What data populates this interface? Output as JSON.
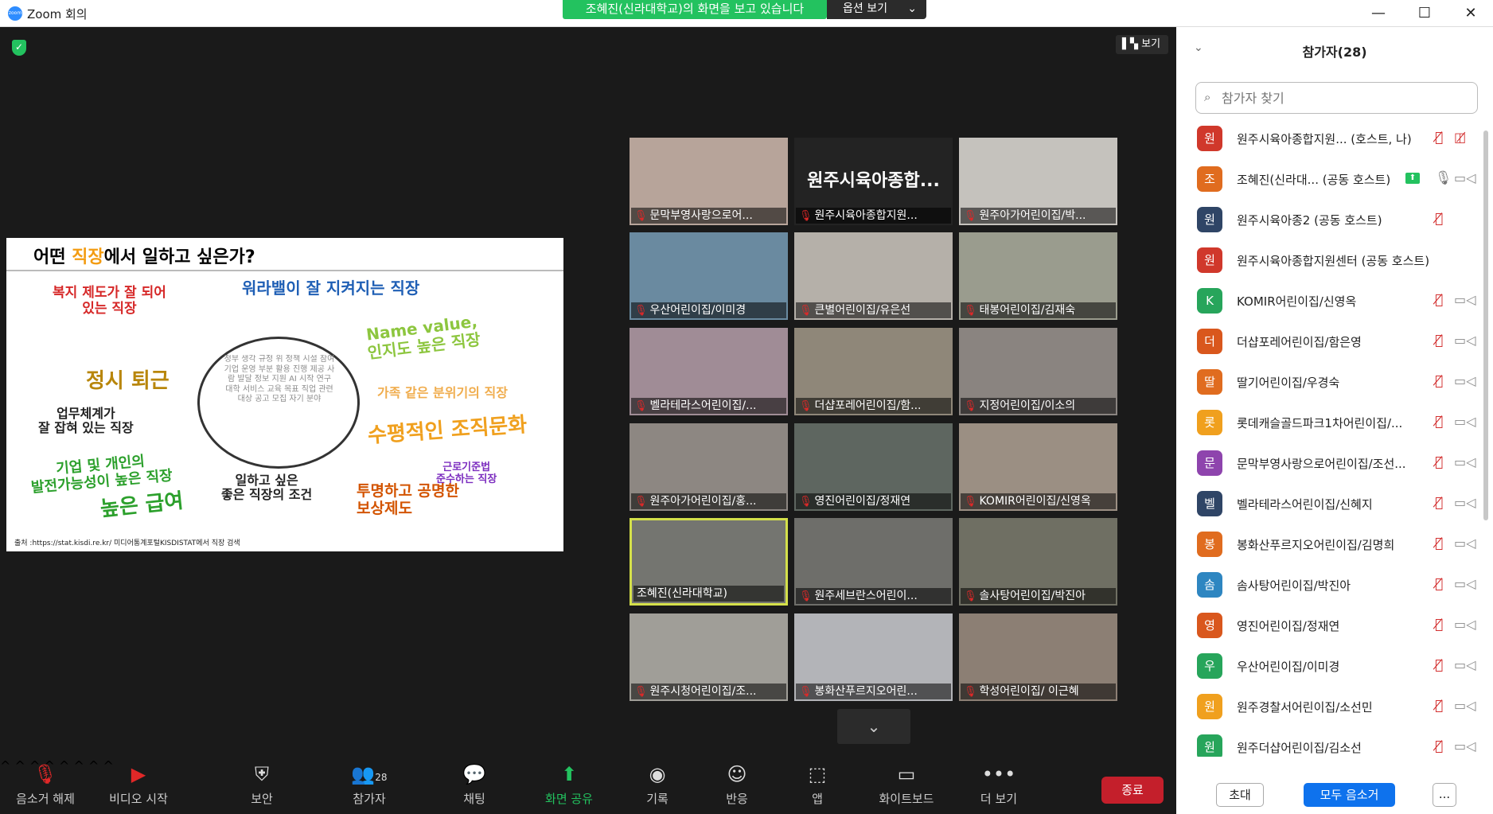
{
  "window": {
    "title": "Zoom 회의",
    "minimize": "—",
    "maximize": "☐",
    "close": "✕"
  },
  "share_banner": {
    "text": "조혜진(신라대학교)의 화면을 보고 있습니다",
    "options_label": "옵션 보기"
  },
  "meeting": {
    "view_label": "보기"
  },
  "slide": {
    "title_pre": "어떤 ",
    "title_hl": "직장",
    "title_post": "에서 일하고 싶은가?",
    "words": {
      "w1": "복지 제도가 잘 되어\n있는 직장",
      "w2": "워라밸이 잘 지켜지는 직장",
      "w3": "Name value,\n인지도 높은 직장",
      "w4": "정시 퇴근",
      "w5": "가족 같은 분위기의 직장",
      "w6": "업무체계가\n잘 잡혀 있는 직장",
      "w7": "수평적인 조직문화",
      "w8": "기업 및 개인의\n발전가능성이 높은 직장",
      "w9": "근로기준법\n준수하는 직장",
      "w10": "높은 급여",
      "w11": "투명하고 공명한\n보상제도",
      "center": "일하고 싶은\n좋은 직장의 조건"
    },
    "cloud": "정부 생각 규정 위 정책 시설 참여 기업 운영 부분 활용 진행 제공 사람 발달 정보 지원 AI 시작 연구 대학 서비스 교육 목표 직업 관련 대상 공고 모집 자기 분야",
    "source": "출처 :https://stat.kisdi.re.kr/ 미디어통계포털KISDISTAT에서 직장 검색"
  },
  "tiles": [
    {
      "label": "문막부영사랑으로어...",
      "muted": true
    },
    {
      "label": "원주시육아종합지원...",
      "muted": true,
      "big": "원주시육아종합..."
    },
    {
      "label": "원주아가어린이집/박...",
      "muted": true
    },
    {
      "label": "우산어린이집/이미경",
      "muted": true
    },
    {
      "label": "큰별어린이집/유은선",
      "muted": true
    },
    {
      "label": "태봉어린이집/김재숙",
      "muted": true
    },
    {
      "label": "벨라테라스어린이집/...",
      "muted": true
    },
    {
      "label": "더샵포레어린이집/함...",
      "muted": true
    },
    {
      "label": "지정어린이집/이소의",
      "muted": true
    },
    {
      "label": "원주아가어린이집/홍...",
      "muted": true
    },
    {
      "label": "영진어린이집/정재연",
      "muted": true
    },
    {
      "label": "KOMIR어린이집/신영옥",
      "muted": true
    },
    {
      "label": "조혜진(신라대학교)",
      "muted": false
    },
    {
      "label": "원주세브란스어린이...",
      "muted": true
    },
    {
      "label": "솔사탕어린이집/박진아",
      "muted": true
    },
    {
      "label": "원주시청어린이집/조...",
      "muted": true
    },
    {
      "label": "봉화산푸르지오어린...",
      "muted": true
    },
    {
      "label": "학성어린이집/ 이근혜",
      "muted": true
    }
  ],
  "toolbar": {
    "unmute": "음소거 해제",
    "video": "비디오 시작",
    "security": "보안",
    "participants": "참가자",
    "participants_count": "28",
    "chat": "채팅",
    "share": "화면 공유",
    "record": "기록",
    "reactions": "반응",
    "apps": "앱",
    "whiteboard": "화이트보드",
    "more": "더 보기",
    "end": "종료"
  },
  "panel": {
    "title": "참가자(28)",
    "search_placeholder": "참가자 찾기",
    "invite": "초대",
    "mute_all": "모두 음소거",
    "more": "..."
  },
  "participants": [
    {
      "initial": "원",
      "color": "#d0382b",
      "name": "원주시육아종합지원... (호스트, 나)",
      "mic": "off",
      "video": "off"
    },
    {
      "initial": "조",
      "color": "#e06c1f",
      "name": "조혜진(신라대... (공동 호스트)",
      "mic": "on",
      "video": "on",
      "sharing": true
    },
    {
      "initial": "원",
      "color": "#2f4566",
      "name": "원주시육아종2 (공동 호스트)",
      "mic": "off",
      "video": "none"
    },
    {
      "initial": "원",
      "color": "#d0382b",
      "name": "원주시육아종합지원센터 (공동 호스트)",
      "mic": "none",
      "video": "none"
    },
    {
      "initial": "K",
      "color": "#27a55b",
      "name": "KOMIR어린이집/신영옥",
      "mic": "off",
      "video": "on"
    },
    {
      "initial": "더",
      "color": "#d9571d",
      "name": "더샵포레어린이집/함은영",
      "mic": "off",
      "video": "on"
    },
    {
      "initial": "딸",
      "color": "#e06c1f",
      "name": "딸기어린이집/우경숙",
      "mic": "off",
      "video": "on"
    },
    {
      "initial": "롯",
      "color": "#f0a01e",
      "name": "롯데캐슬골드파크1차어린이집/...",
      "mic": "off",
      "video": "on"
    },
    {
      "initial": "문",
      "color": "#8e44ad",
      "name": "문막부영사랑으로어린이집/조선...",
      "mic": "off",
      "video": "on"
    },
    {
      "initial": "벨",
      "color": "#2f4566",
      "name": "벨라테라스어린이집/신혜지",
      "mic": "off",
      "video": "on"
    },
    {
      "initial": "봉",
      "color": "#e06c1f",
      "name": "봉화산푸르지오어린이집/김명희",
      "mic": "off",
      "video": "on"
    },
    {
      "initial": "솜",
      "color": "#2e86c1",
      "name": "솜사탕어린이집/박진아",
      "mic": "off",
      "video": "on"
    },
    {
      "initial": "영",
      "color": "#d9571d",
      "name": "영진어린이집/정재연",
      "mic": "off",
      "video": "on"
    },
    {
      "initial": "우",
      "color": "#27a55b",
      "name": "우산어린이집/이미경",
      "mic": "off",
      "video": "on"
    },
    {
      "initial": "원",
      "color": "#f0a01e",
      "name": "원주경찰서어린이집/소선민",
      "mic": "off",
      "video": "on"
    },
    {
      "initial": "원",
      "color": "#27a55b",
      "name": "원주더샵어린이집/김소선",
      "mic": "off",
      "video": "on"
    }
  ],
  "colors": {
    "accent": "#0e72ed",
    "share_green": "#23c25f",
    "end_red": "#c41f2b",
    "muted_red": "#d32f2f"
  }
}
